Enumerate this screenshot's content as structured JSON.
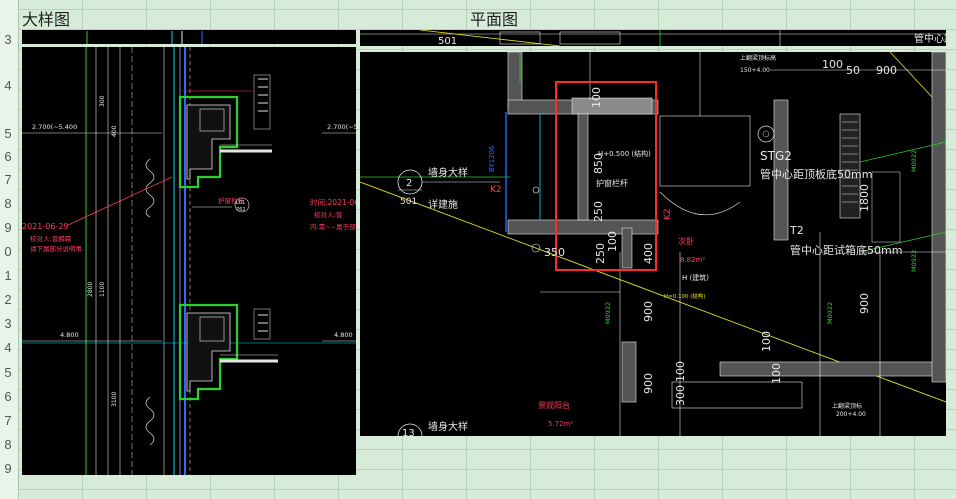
{
  "sheet": {
    "headers": {
      "detail": "大样图",
      "plan": "平面图"
    },
    "row_numbers": [
      "3",
      "4",
      "5",
      "6",
      "7",
      "8",
      "9",
      "0",
      "1",
      "2",
      "3",
      "4",
      "5",
      "6",
      "7",
      "8",
      "9"
    ]
  },
  "detail": {
    "elev_top": "2.700(~5.400",
    "elev_top_r": "2.700(~5.4",
    "elev_mid_l": "4.800",
    "elev_mid_r": "4.800",
    "date_left": "2021-06-29",
    "note_left_1": "校对人:曾麟霖",
    "note_left_2": "请下属部分说明事",
    "date_right": "时间:2021-06-",
    "note_right_1": "校对人:曾",
    "note_right_2": "内:需~~属于部分",
    "dim_2800": "2800",
    "dim_1100": "1100",
    "dim_400": "400",
    "dim_3100": "3100",
    "dim_300": "300",
    "label_L01": "L01",
    "label_762": "762",
    "label_fj": "护窗栏杆"
  },
  "plan": {
    "top_label": "501",
    "stg2": "STG2",
    "stg2_note": "管中心距顶板底50mm",
    "t2": "T2",
    "t2_note": "管中心距试箱底50mm",
    "wall_detail_1": "墙身大样",
    "detail_note": "详建施",
    "circle_num": "2",
    "circle_den": "501",
    "circle2_num": "13",
    "wall_detail_2": "墙身大样",
    "by": "BY1206",
    "h_level": "H+0.500 (结构)",
    "guard": "护窗栏杆",
    "room": "次卧",
    "area": "8.82m²",
    "h_label": "H (建筑)",
    "h_small": "H=0.100 (结构)",
    "balcony": "景观阳台",
    "balcony_area": "5.72m²",
    "top_right": "管中心距",
    "top_elev": "上翻梁顶标高",
    "top_elev_val": "150+4.00",
    "bottom_elev": "上翻梁顶标",
    "bottom_elev_val": "200+4.00",
    "m0922_a": "M0922",
    "m0922_b": "M0922",
    "m0922_c": "M0922",
    "m0922_d": "M0922",
    "dims": {
      "d100a": "100",
      "d50": "50",
      "d900a": "900",
      "d100b": "100",
      "d850": "850",
      "d250a": "250",
      "d250b": "250",
      "d100c": "100",
      "d400": "400",
      "d350": "350",
      "d1800": "1800",
      "d900b": "900",
      "d900c": "900",
      "d900d": "900",
      "d100d": "100",
      "d300": "300",
      "d100e": "100",
      "d100f": "100",
      "k2a": "K2",
      "k2b": "K2"
    }
  },
  "colors": {
    "cad_bg": "#000000",
    "wall_green": "#2bd02b",
    "dim_white": "#e6e6e6",
    "annot_red": "#ff3b5c",
    "highlight_red": "#ff2a2a",
    "cyan": "#00d6ff",
    "yellow": "#e8e020",
    "blue": "#2a6bff"
  }
}
